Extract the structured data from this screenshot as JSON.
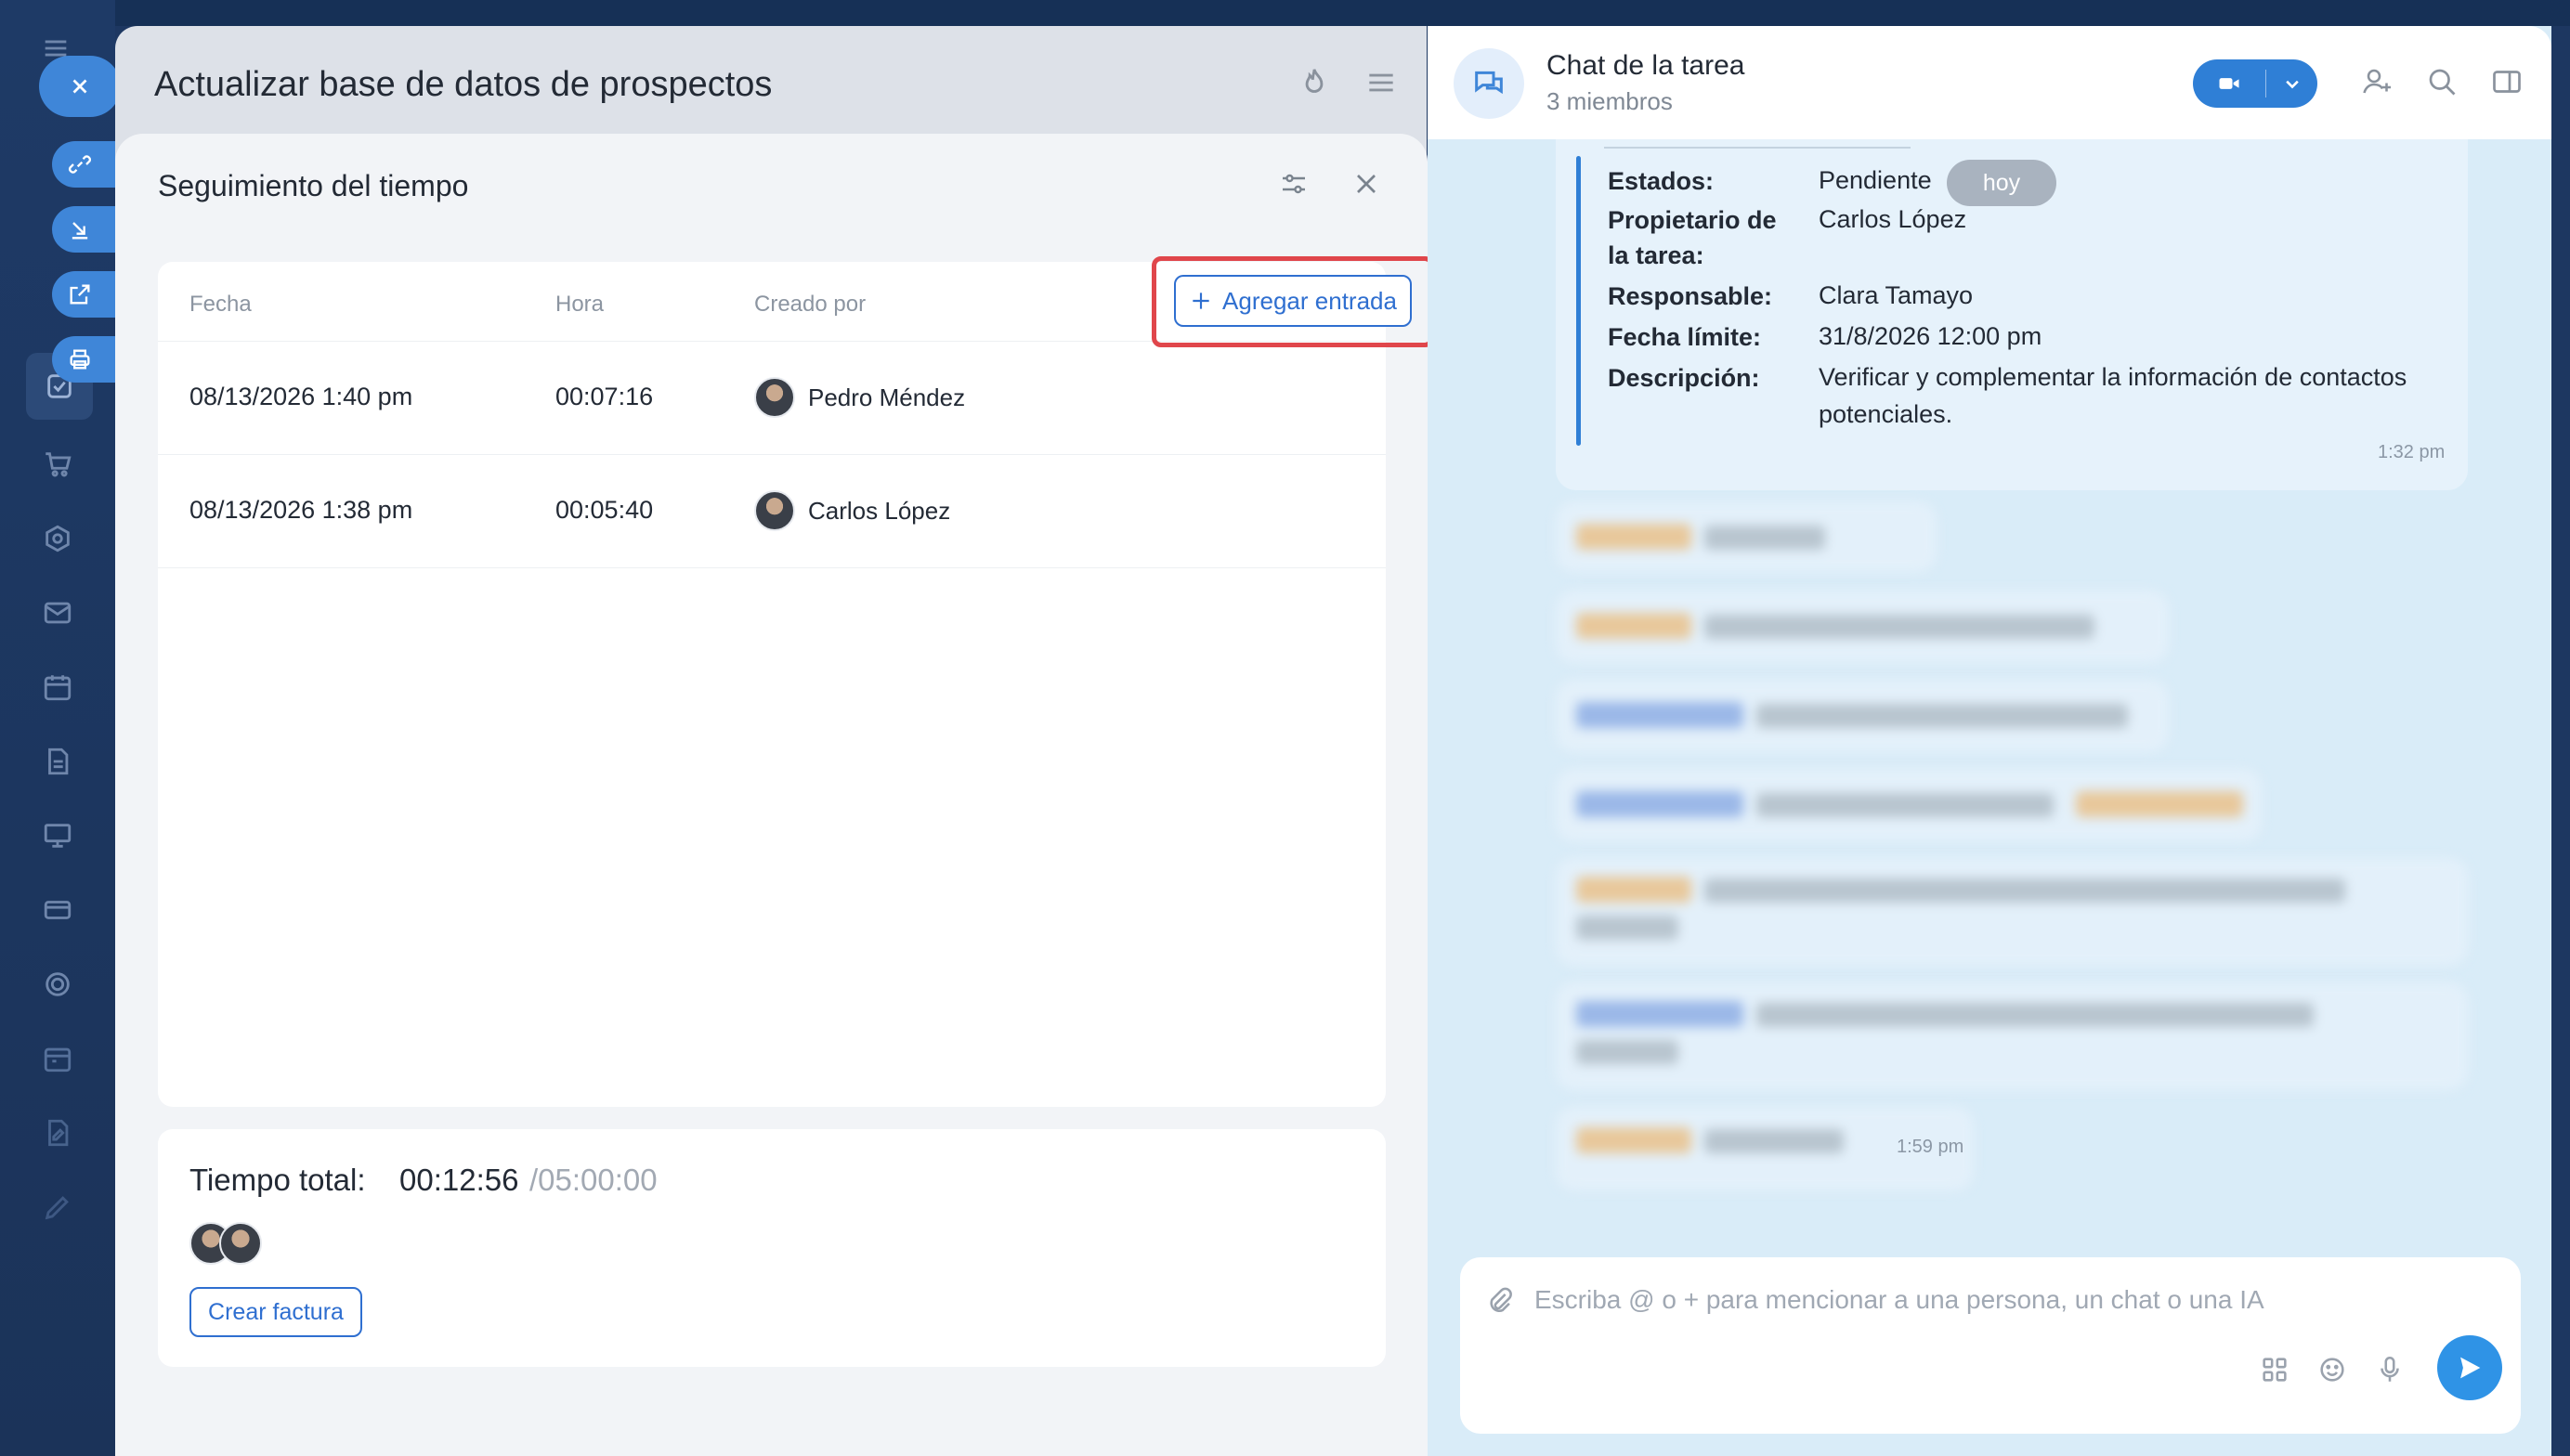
{
  "top_bar": {
    "zoom": "100%"
  },
  "task": {
    "title": "Actualizar base de datos de prospectos"
  },
  "time_tracking": {
    "title": "Seguimiento del tiempo",
    "columns": {
      "date": "Fecha",
      "time": "Hora",
      "created_by": "Creado por"
    },
    "add_entry_label": "Agregar entrada",
    "rows": [
      {
        "date": "08/13/2026 1:40 pm",
        "time": "00:07:16",
        "user": "Pedro Méndez"
      },
      {
        "date": "08/13/2026 1:38 pm",
        "time": "00:05:40",
        "user": "Carlos López"
      }
    ],
    "total_label": "Tiempo total:",
    "total_value": "00:12:56",
    "total_limit": "/05:00:00",
    "invoice_label": "Crear factura"
  },
  "chat": {
    "title": "Chat de la tarea",
    "subtitle": "3 miembros",
    "task_card": {
      "status_key": "Estados:",
      "status_val": "Pendiente",
      "owner_key_1": "Propietario de",
      "owner_key_2": "la tarea:",
      "owner_val": "Carlos López",
      "responsible_key": "Responsable:",
      "responsible_val": "Clara Tamayo",
      "deadline_key": "Fecha límite:",
      "deadline_val": "31/8/2026 12:00 pm",
      "description_key": "Descripción:",
      "description_val_1": "Verificar y complementar la información de contactos",
      "description_val_2": "potenciales.",
      "time": "1:32 pm"
    },
    "date_badge": "hoy",
    "last_time": "1:59 pm",
    "input_placeholder": "Escriba @ o + para mencionar a una persona, un chat o una IA"
  }
}
